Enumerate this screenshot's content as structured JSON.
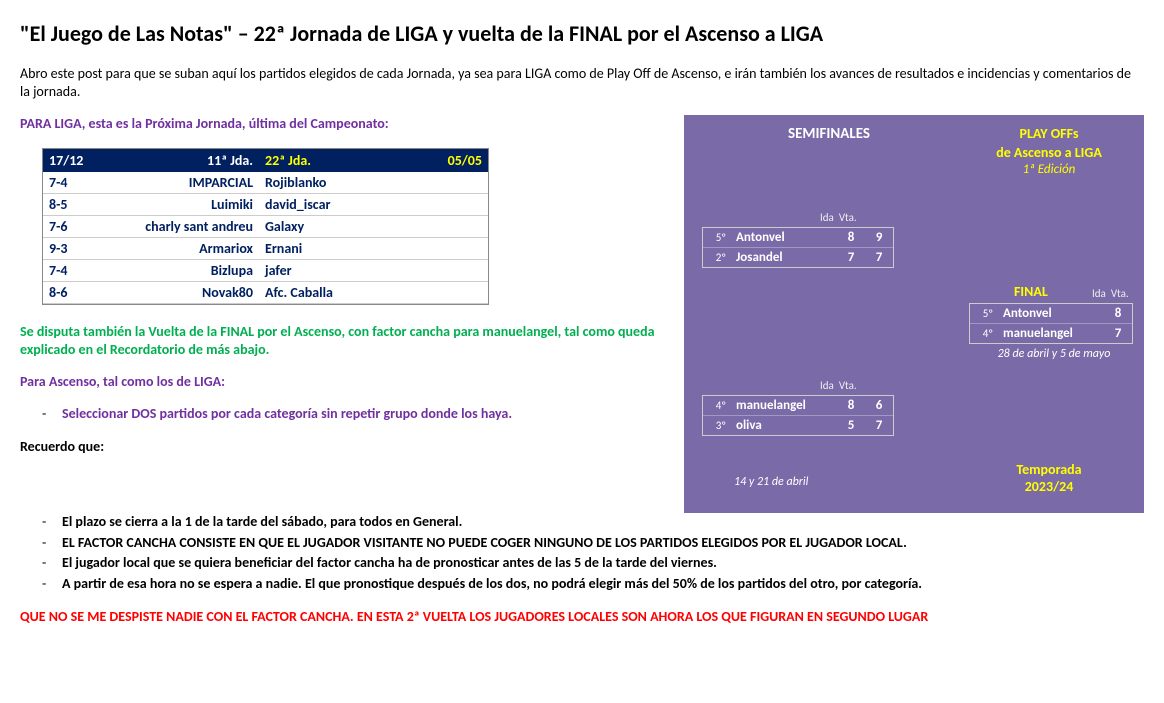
{
  "title": "\"El Juego de Las Notas\" – 22ª Jornada de LIGA y vuelta de la FINAL por el Ascenso a LIGA",
  "intro": "Abro este post para que se suban aquí los partidos elegidos de cada Jornada, ya sea para LIGA como de Play Off de Ascenso, e irán también los avances de resultados e incidencias y comentarios de la jornada.",
  "liga_heading": "PARA LIGA, esta es la Próxima Jornada, última del Campeonato:",
  "liga_table": {
    "h1": "17/12",
    "h2": "11ª Jda.",
    "h3": "22ª Jda.",
    "h4": "05/05",
    "rows": [
      {
        "score": "7-4",
        "home": "IMPARCIAL",
        "away": "Rojiblanko"
      },
      {
        "score": "8-5",
        "home": "Luimiki",
        "away": "david_iscar"
      },
      {
        "score": "7-6",
        "home": "charly sant andreu",
        "away": "Galaxy"
      },
      {
        "score": "9-3",
        "home": "Armariox",
        "away": "Ernani"
      },
      {
        "score": "7-4",
        "home": "Bizlupa",
        "away": "jafer"
      },
      {
        "score": "8-6",
        "home": "Novak80",
        "away": "Afc. Caballa"
      }
    ]
  },
  "green_note": "Se disputa también la Vuelta de la FINAL por el Ascenso, con factor cancha para manuelangel, tal como queda explicado en el Recordatorio de más abajo.",
  "ascenso_heading": "Para Ascenso, tal como los de LIGA:",
  "ascenso_rule": "Seleccionar DOS partidos por cada categoría sin repetir grupo donde los haya.",
  "recuerdo_label": "Recuerdo que:",
  "recuerdo": [
    "El  plazo se cierra a la 1 de la tarde del sábado, para todos en General.",
    "EL FACTOR CANCHA CONSISTE EN QUE EL JUGADOR VISITANTE NO PUEDE COGER NINGUNO DE LOS PARTIDOS ELEGIDOS POR EL JUGADOR LOCAL.",
    "El jugador local que se quiera beneficiar del factor cancha ha de pronosticar antes de las 5 de la tarde del viernes.",
    "A partir de esa hora no se espera a nadie. El que pronostique después de los dos, no podrá elegir más del 50% de los partidos del otro, por categoría."
  ],
  "warning": "QUE NO SE ME DESPISTE NADIE CON EL FACTOR CANCHA. EN ESTA 2ª VUELTA LOS JUGADORES LOCALES SON AHORA LOS QUE FIGURAN EN SEGUNDO LUGAR",
  "playoff": {
    "semis_label": "SEMIFINALES",
    "title1": "PLAY OFFs",
    "title2": "de Ascenso a LIGA",
    "edition": "1ª Edición",
    "ida": "Ida",
    "vta": "Vta.",
    "semi1": [
      {
        "seed": "5º",
        "name": "Antonvel",
        "ida": "8",
        "vta": "9"
      },
      {
        "seed": "2º",
        "name": "Josandel",
        "ida": "7",
        "vta": "7"
      }
    ],
    "semi2": [
      {
        "seed": "4º",
        "name": "manuelangel",
        "ida": "8",
        "vta": "6"
      },
      {
        "seed": "3º",
        "name": "oliva",
        "ida": "5",
        "vta": "7"
      }
    ],
    "final_label": "FINAL",
    "final": [
      {
        "seed": "5º",
        "name": "Antonvel",
        "ida": "8",
        "vta": ""
      },
      {
        "seed": "4º",
        "name": "manuelangel",
        "ida": "7",
        "vta": ""
      }
    ],
    "final_date": "28 de abril y 5 de mayo",
    "semi_date": "14 y 21 de abril",
    "season_label": "Temporada",
    "season": "2023/24"
  }
}
